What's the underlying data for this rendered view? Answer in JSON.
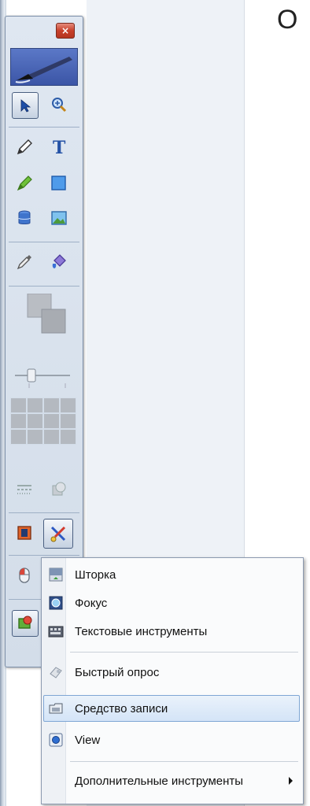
{
  "background": {
    "corner_text": "O"
  },
  "toolbar": {
    "close_label": "×",
    "tools": [
      "select-arrow-icon",
      "zoom-icon",
      "pen-icon",
      "text-tool-icon",
      "highlighter-icon",
      "shape-icon",
      "database-icon",
      "image-icon",
      "eyedropper-icon",
      "fill-bucket-icon",
      "color-swatch-icon",
      "size-slider-icon",
      "grid-palette-icon",
      "line-style-icon",
      "transparency-icon",
      "recorder-icon",
      "tools-scissors-icon",
      "mouse-icon",
      "screen-capture-icon"
    ]
  },
  "menu": {
    "items": [
      {
        "label": "Шторка",
        "icon": "curtain-icon"
      },
      {
        "label": "Фокус",
        "icon": "focus-icon"
      },
      {
        "label": "Текстовые инструменты",
        "icon": "keyboard-icon"
      },
      {
        "label": "Быстрый опрос",
        "icon": "quick-poll-icon"
      },
      {
        "label": "Средство записи",
        "icon": "recorder-folder-icon",
        "selected": true
      },
      {
        "label": "View",
        "icon": "view-icon"
      },
      {
        "label": "Дополнительные инструменты",
        "icon": "",
        "has_submenu": true
      }
    ]
  },
  "colors": {
    "toolbar_bg": "#d3dde9",
    "menu_bg": "#fafbfc",
    "selected_bg": "#d4e4f7",
    "close_red": "#c7402b",
    "brush_header_blue": "#3b55a6"
  }
}
